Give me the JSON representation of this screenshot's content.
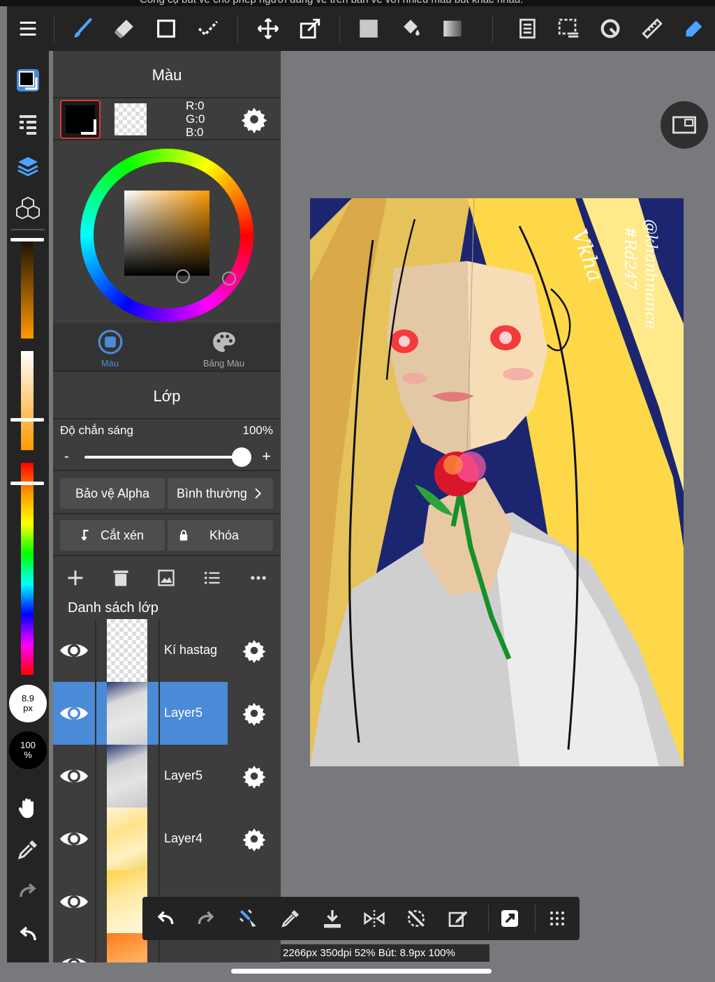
{
  "caption": "Công cụ bút vẽ cho phép người dùng vẽ trên bản vẽ với nhiều màu bút khác nhau.",
  "toolbar": {
    "items": [
      "menu-icon",
      "brush-icon",
      "eraser-icon",
      "rectangle-icon",
      "dotted-line-icon",
      "move-icon",
      "transform-icon",
      "fill-square-icon",
      "bucket-icon",
      "gradient-icon",
      "layers-doc-icon",
      "selection-icon",
      "lasso-icon",
      "ruler-icon",
      "pen-select-icon"
    ]
  },
  "leftbar": {
    "brush_size": "8.9",
    "brush_size_unit": "px",
    "opacity": "100",
    "opacity_unit": "%"
  },
  "color_panel": {
    "title": "Màu",
    "rgb": {
      "r": "R:0",
      "g": "G:0",
      "b": "B:0"
    },
    "tab_color": "Màu",
    "tab_palette": "Bảng Màu",
    "accent": "#4b8ad6"
  },
  "layer_panel": {
    "title": "Lớp",
    "opacity_label": "Độ chắn sáng",
    "opacity_value": "100%",
    "opacity_fraction": 1.0,
    "minus": "-",
    "plus": "+",
    "alpha_protect": "Bảo vệ Alpha",
    "blend_mode": "Bình thường",
    "clipping": "Cắt xén",
    "lock": "Khóa",
    "list_title": "Danh sách lớp",
    "layers": [
      {
        "name": "Kí hastag",
        "selected": false
      },
      {
        "name": "Layer5",
        "selected": true
      },
      {
        "name": "Layer5",
        "selected": false
      },
      {
        "name": "Layer4",
        "selected": false
      },
      {
        "name": "",
        "selected": false
      },
      {
        "name": "",
        "selected": false
      }
    ]
  },
  "artwork": {
    "signature_1": "@khanhnance",
    "signature_2": "#Rd247"
  },
  "status_bar": "2266px 350dpi 52% Bút: 8.9px 100%"
}
